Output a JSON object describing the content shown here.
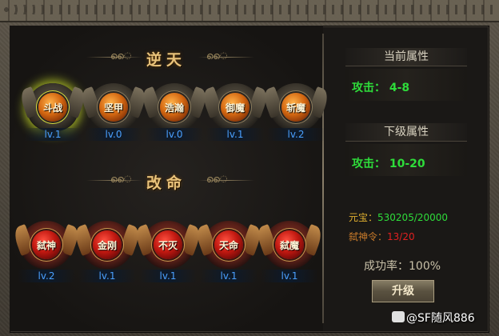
{
  "sections": {
    "top_title": "逆天",
    "bottom_title": "改命"
  },
  "top_skills": [
    {
      "name": "斗战",
      "level": "lv.1",
      "active": true
    },
    {
      "name": "坚甲",
      "level": "lv.0"
    },
    {
      "name": "浩瀚",
      "level": "lv.0"
    },
    {
      "name": "御魔",
      "level": "lv.1"
    },
    {
      "name": "斩魔",
      "level": "lv.2"
    }
  ],
  "bottom_skills": [
    {
      "name": "弑神",
      "level": "lv.2"
    },
    {
      "name": "金刚",
      "level": "lv.1"
    },
    {
      "name": "不灭",
      "level": "lv.1"
    },
    {
      "name": "天命",
      "level": "lv.1"
    },
    {
      "name": "弑魔",
      "level": "lv.1"
    }
  ],
  "panel": {
    "current_header": "当前属性",
    "current_value": "攻击： 4-8",
    "next_header": "下级属性",
    "next_value": "攻击： 10-20",
    "yuanbao_label": "元宝：",
    "yuanbao_value": "530205/20000",
    "token_label": "弑神令：",
    "token_value": "13/20",
    "success_rate": "成功率：100%",
    "upgrade_button": "升级"
  },
  "watermark": "@SF随风886",
  "colors": {
    "title_gold": "#e8c27a",
    "level_blue": "#4aa0ff",
    "attr_green": "#2edc3a",
    "yuanbao_label": "#e0b030",
    "yuanbao_value": "#2edc3a",
    "token_label": "#c87a2a",
    "token_value": "#e02020"
  }
}
